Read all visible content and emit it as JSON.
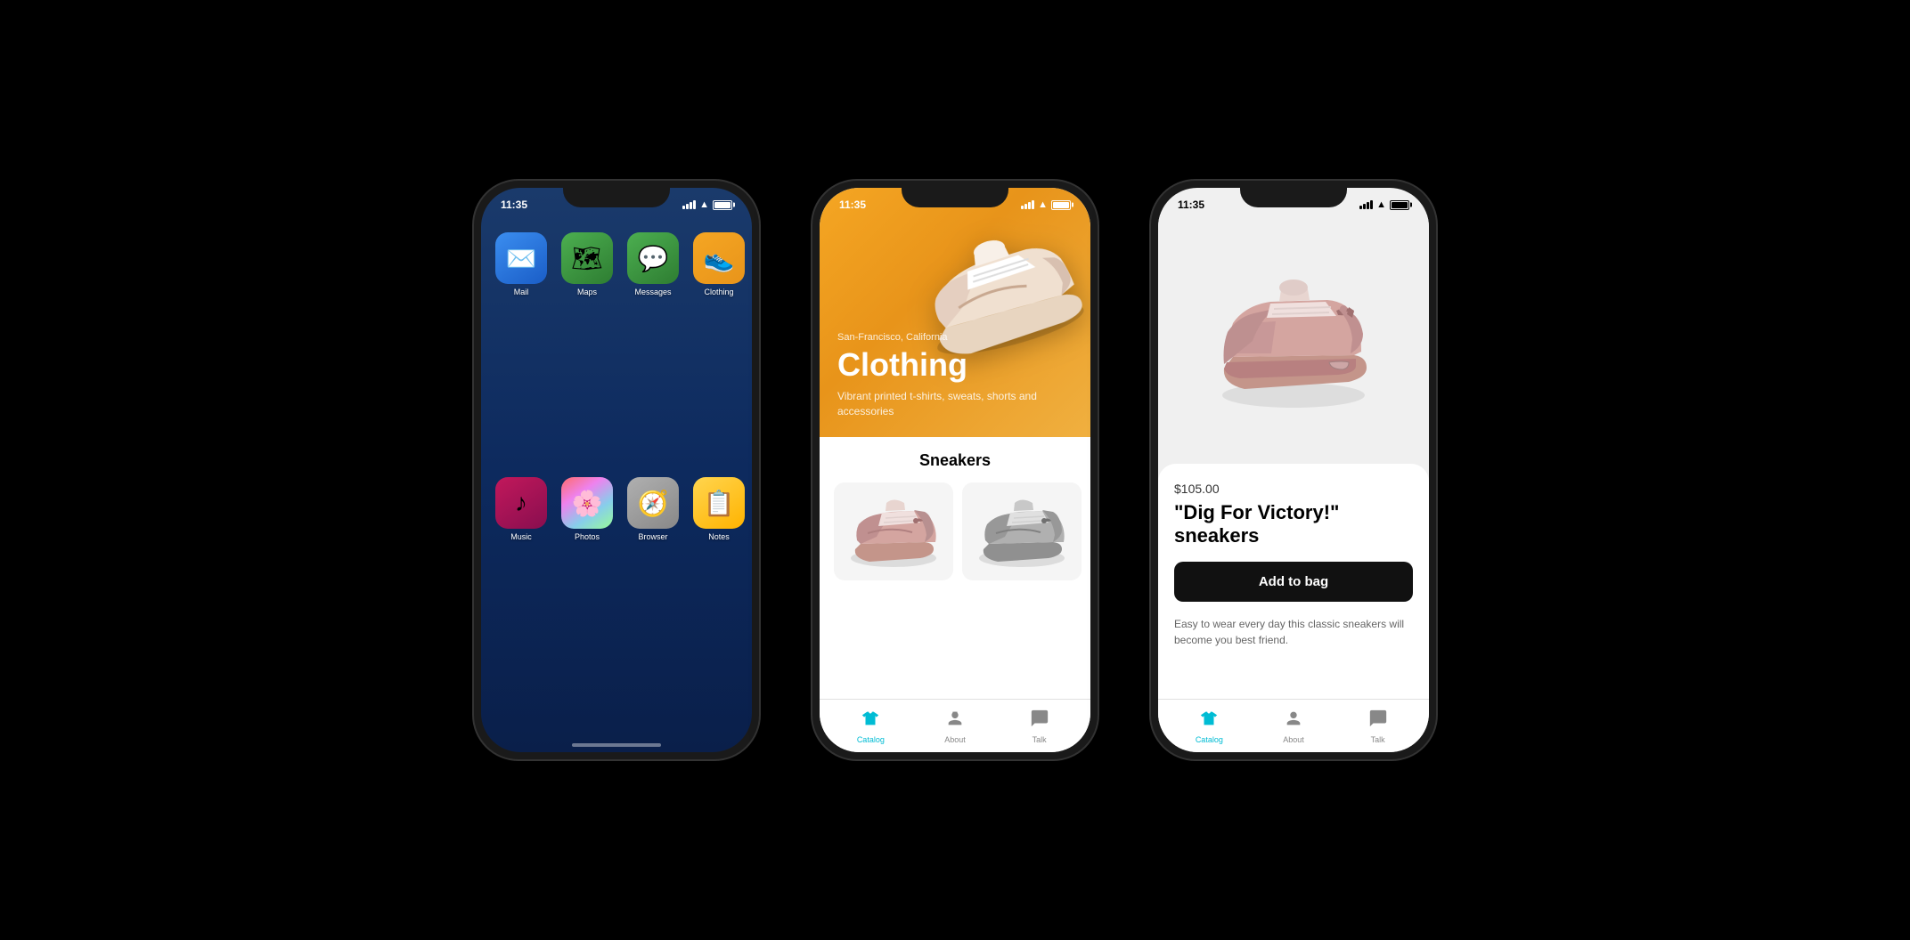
{
  "phone1": {
    "status_time": "11:35",
    "apps": [
      {
        "id": "mail",
        "label": "Mail",
        "icon": "✉️",
        "class": "mail"
      },
      {
        "id": "maps",
        "label": "Maps",
        "icon": "🗺",
        "class": "maps"
      },
      {
        "id": "messages",
        "label": "Messages",
        "icon": "💬",
        "class": "messages"
      },
      {
        "id": "clothing",
        "label": "Clothing",
        "icon": "👟",
        "class": "clothing"
      },
      {
        "id": "music",
        "label": "Music",
        "icon": "♪",
        "class": "music"
      },
      {
        "id": "photos",
        "label": "Photos",
        "icon": "🌸",
        "class": "photos"
      },
      {
        "id": "browser",
        "label": "Browser",
        "icon": "🧭",
        "class": "browser"
      },
      {
        "id": "notes",
        "label": "Notes",
        "icon": "📋",
        "class": "notes"
      }
    ]
  },
  "phone2": {
    "status_time": "11:35",
    "hero": {
      "location": "San-Francisco, California",
      "title": "Clothing",
      "subtitle": "Vibrant printed t-shirts, sweats, shorts and accessories"
    },
    "section_title": "Sneakers",
    "tabs": [
      {
        "id": "catalog",
        "label": "Catalog",
        "active": true
      },
      {
        "id": "about",
        "label": "About",
        "active": false
      },
      {
        "id": "talk",
        "label": "Talk",
        "active": false
      }
    ]
  },
  "phone3": {
    "status_time": "11:35",
    "product": {
      "price": "$105.00",
      "name": "\"Dig For Victory!\" sneakers",
      "add_to_bag": "Add to bag",
      "description": "Easy to wear every day this classic sneakers will become you best friend."
    },
    "tabs": [
      {
        "id": "catalog",
        "label": "Catalog",
        "active": true
      },
      {
        "id": "about",
        "label": "About",
        "active": false
      },
      {
        "id": "talk",
        "label": "Talk",
        "active": false
      }
    ]
  },
  "colors": {
    "active_tab": "#00bcd4",
    "inactive_tab": "#888888",
    "hero_orange": "#f5a623",
    "add_to_bag_bg": "#111111",
    "phone_bg": "#1a1a1a"
  },
  "icons": {
    "signal": "signal-icon",
    "wifi": "wifi-icon",
    "battery": "battery-icon",
    "catalog_tab": "tshirt-icon",
    "about_tab": "person-icon",
    "talk_tab": "chat-icon"
  }
}
